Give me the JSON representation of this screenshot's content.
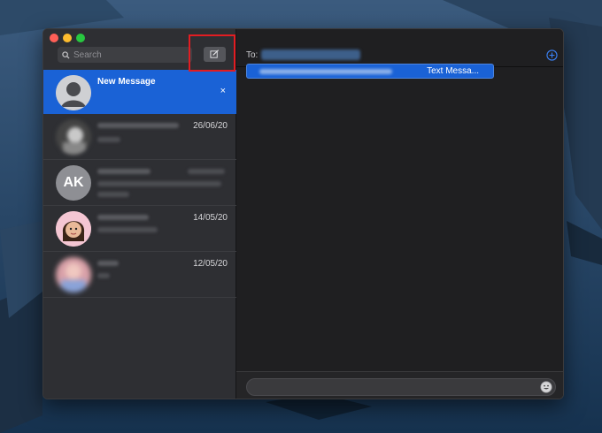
{
  "search": {
    "placeholder": "Search"
  },
  "conversations": [
    {
      "name": "New Message",
      "close_label": "×"
    },
    {
      "date": "26/06/20"
    },
    {
      "initials": "AK"
    },
    {
      "date": "14/05/20"
    },
    {
      "date": "12/05/20"
    }
  ],
  "compose": {
    "to_label": "To:",
    "suggestion_label": "Text Messa..."
  },
  "colors": {
    "selection_blue": "#1a62d6",
    "highlight_red": "#e21d22"
  }
}
